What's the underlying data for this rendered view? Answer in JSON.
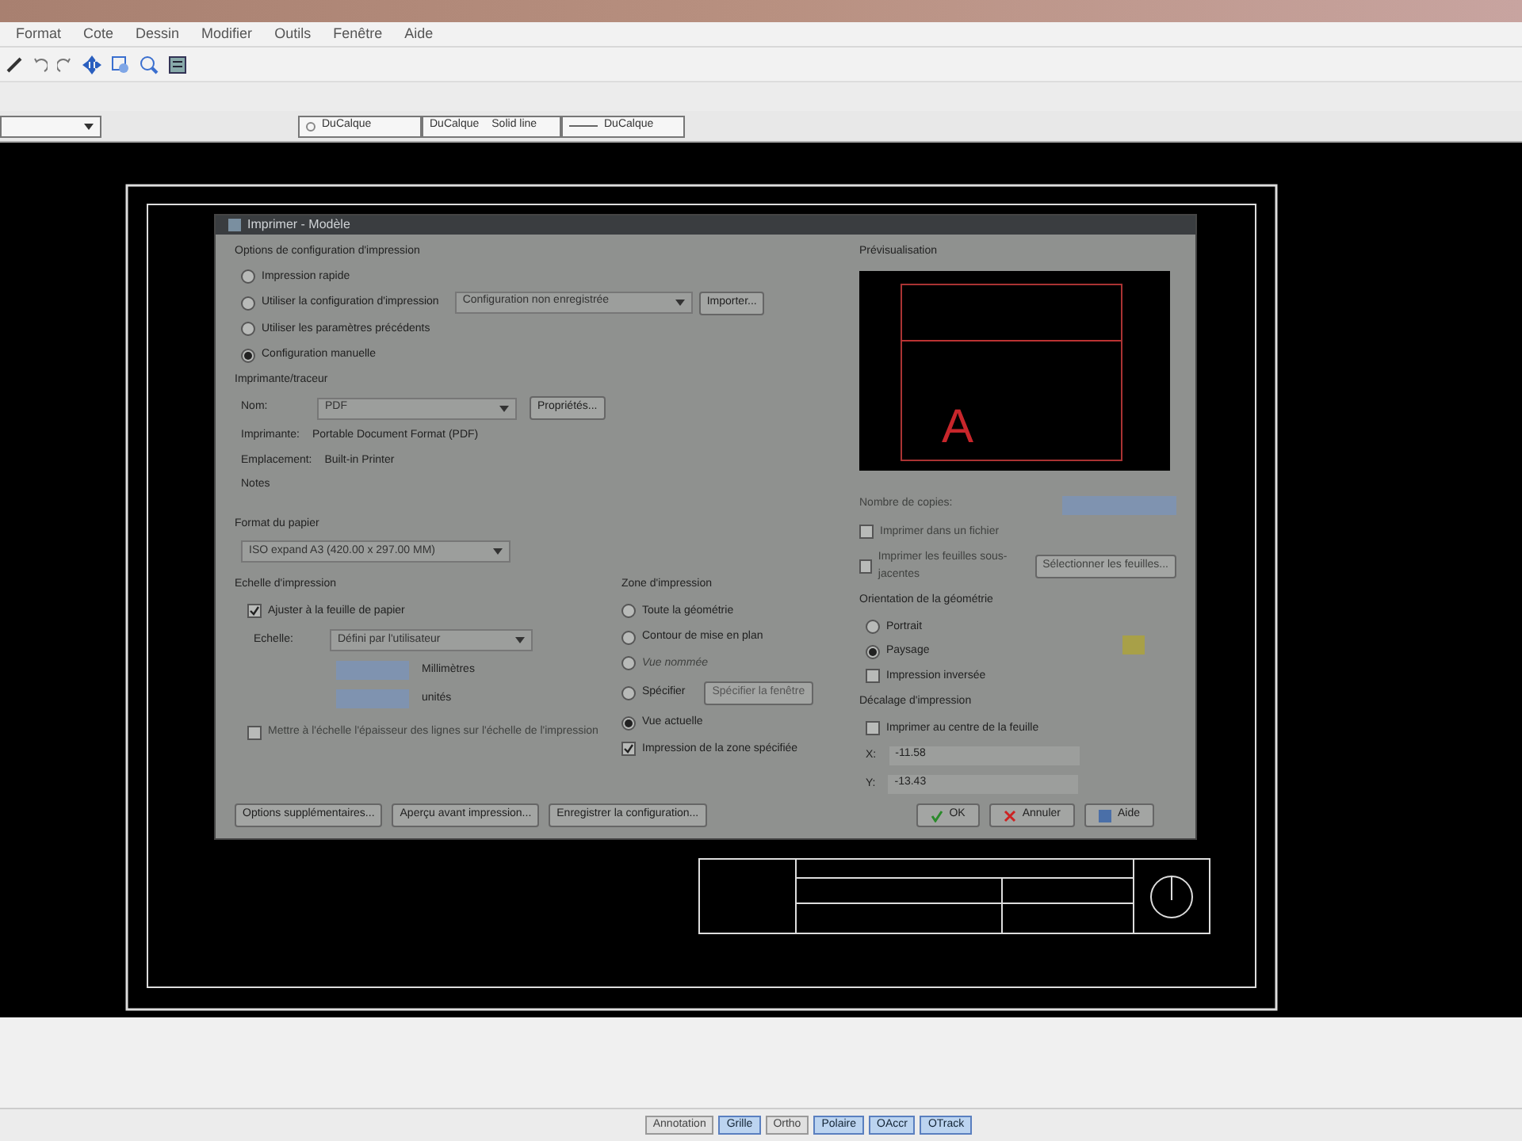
{
  "menu": [
    "Format",
    "Cote",
    "Dessin",
    "Modifier",
    "Outils",
    "Fenêtre",
    "Aide"
  ],
  "layer_toolbar": {
    "color_setting": "DuCalque",
    "linetype": "DuCalque",
    "lineweight_type": "Solid line",
    "lineweight": "DuCalque"
  },
  "dialog": {
    "title": "Imprimer - Modèle",
    "setup_group": {
      "title": "Options de configuration d'impression",
      "options": [
        {
          "label": "Impression rapide",
          "selected": false
        },
        {
          "label": "Utiliser la configuration d'impression",
          "selected": false
        },
        {
          "label": "Utiliser les paramètres précédents",
          "selected": false
        },
        {
          "label": "Configuration manuelle",
          "selected": true
        }
      ],
      "config_select": "Configuration non enregistrée",
      "import_button": "Importer..."
    },
    "printer": {
      "title": "Imprimante/traceur",
      "name_label": "Nom:",
      "name_value": "PDF",
      "properties_button": "Propriétés...",
      "printer_label": "Imprimante:",
      "printer_value": "Portable Document Format (PDF)",
      "location_label": "Emplacement:",
      "location_value": "Built-in Printer",
      "notes_label": "Notes"
    },
    "paper": {
      "title": "Format du papier",
      "value": "ISO expand A3 (420.00 x 297.00 MM)"
    },
    "scale": {
      "title": "Echelle d'impression",
      "fit": {
        "label": "Ajuster à la feuille de papier",
        "checked": true
      },
      "scale_label": "Echelle:",
      "scale_value": "Défini par l'utilisateur",
      "unit": "Millimètres",
      "unit2": "unités",
      "lineweights": {
        "label": "Mettre à l'échelle l'épaisseur des lignes sur l'échelle de l'impression",
        "checked": false
      }
    },
    "area": {
      "title": "Zone d'impression",
      "options": [
        {
          "label": "Toute la géométrie",
          "selected": false,
          "disabled": false
        },
        {
          "label": "Contour de mise en plan",
          "selected": false,
          "disabled": false
        },
        {
          "label": "Vue nommée",
          "selected": false,
          "disabled": true
        },
        {
          "label": "Spécifier",
          "selected": false,
          "disabled": false
        },
        {
          "label": "Vue actuelle",
          "selected": true,
          "disabled": false
        }
      ],
      "specify_button": "Spécifier la fenêtre",
      "specified": {
        "label": "Impression de la zone spécifiée",
        "checked": true
      }
    },
    "bottom_buttons": [
      "Options supplémentaires...",
      "Aperçu avant impression...",
      "Enregistrer la configuration..."
    ],
    "preview": {
      "title": "Prévisualisation",
      "letter": "A"
    },
    "copies": {
      "label": "Nombre de copies:",
      "to_file": {
        "label": "Imprimer dans un fichier",
        "checked": false
      },
      "sheets": {
        "label": "Imprimer les feuilles sous-jacentes",
        "checked": false
      },
      "select_sheets": "Sélectionner les feuilles..."
    },
    "orientation": {
      "title": "Orientation de la géométrie",
      "options": [
        {
          "label": "Portrait",
          "selected": false
        },
        {
          "label": "Paysage",
          "selected": true
        }
      ],
      "inverted": {
        "label": "Impression inversée",
        "checked": false
      }
    },
    "offset": {
      "title": "Décalage d'impression",
      "center": {
        "label": "Imprimer au centre de la feuille",
        "checked": false
      },
      "x_label": "X:",
      "x_value": "-11.58",
      "y_label": "Y:",
      "y_value": "-13.43"
    },
    "actions": [
      {
        "kind": "ok",
        "label": "OK"
      },
      {
        "kind": "cancel",
        "label": "Annuler"
      },
      {
        "kind": "help",
        "label": "Aide"
      }
    ]
  },
  "status_bar": [
    {
      "label": "Annotation",
      "on": false
    },
    {
      "label": "Grille",
      "on": true
    },
    {
      "label": "Ortho",
      "on": false
    },
    {
      "label": "Polaire",
      "on": true
    },
    {
      "label": "OAccr",
      "on": true
    },
    {
      "label": "OTrack",
      "on": true
    }
  ]
}
